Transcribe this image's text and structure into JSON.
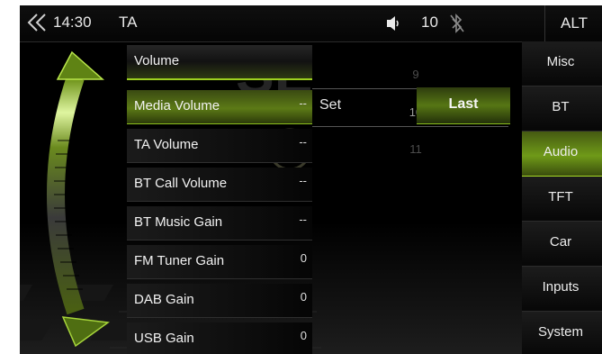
{
  "status_bar": {
    "time": "14:30",
    "source": "TA",
    "volume": "10",
    "alt_label": "ALT",
    "back_icon": "back-chevrons-icon",
    "speaker_icon": "speaker-icon",
    "bluetooth_icon": "bluetooth-disabled-icon"
  },
  "settings": {
    "header": "Volume",
    "items": [
      {
        "label": "Media Volume",
        "value": "--"
      },
      {
        "label": "TA Volume",
        "value": "--"
      },
      {
        "label": "BT Call Volume",
        "value": "--"
      },
      {
        "label": "BT Music Gain",
        "value": "--"
      },
      {
        "label": "FM Tuner Gain",
        "value": "0"
      },
      {
        "label": "DAB Gain",
        "value": "0"
      },
      {
        "label": "USB Gain",
        "value": "0"
      }
    ]
  },
  "picker": {
    "set_label": "Set",
    "values": [
      "9",
      "10",
      "11"
    ],
    "selected": "10",
    "last_label": "Last"
  },
  "tabs": {
    "items": [
      "Misc",
      "BT",
      "Audio",
      "TFT",
      "Car",
      "Inputs",
      "System"
    ],
    "active": "Audio"
  },
  "colors": {
    "accent": "#8cbf1d",
    "background": "#000000",
    "text": "#f0f0f0"
  }
}
